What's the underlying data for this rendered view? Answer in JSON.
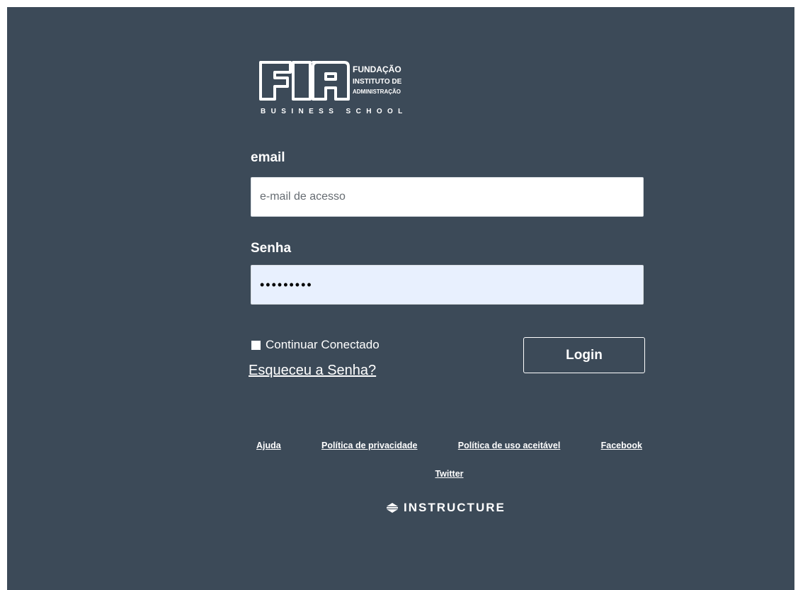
{
  "logo": {
    "mark": "FIA",
    "line1": "FUNDAÇÃO",
    "line2": "INSTITUTO DE",
    "line3": "ADMINISTRAÇÃO",
    "tagline": "BUSINESS SCHOOL"
  },
  "form": {
    "email_label": "email",
    "email_placeholder": "e-mail de acesso",
    "email_value": "",
    "password_label": "Senha",
    "password_value": "•••••••••",
    "remember_label": "Continuar Conectado",
    "remember_checked": false,
    "forgot_label": "Esqueceu a Senha?",
    "login_label": "Login"
  },
  "footer": {
    "links": [
      "Ajuda",
      "Política de privacidade",
      "Política de uso aceitável",
      "Facebook"
    ],
    "twitter": "Twitter",
    "brand": "INSTRUCTURE",
    "brand_icon": "instructure-logo-icon"
  },
  "colors": {
    "background": "#3c4a58",
    "password_bg": "#e8f0fe",
    "text": "#ffffff"
  }
}
